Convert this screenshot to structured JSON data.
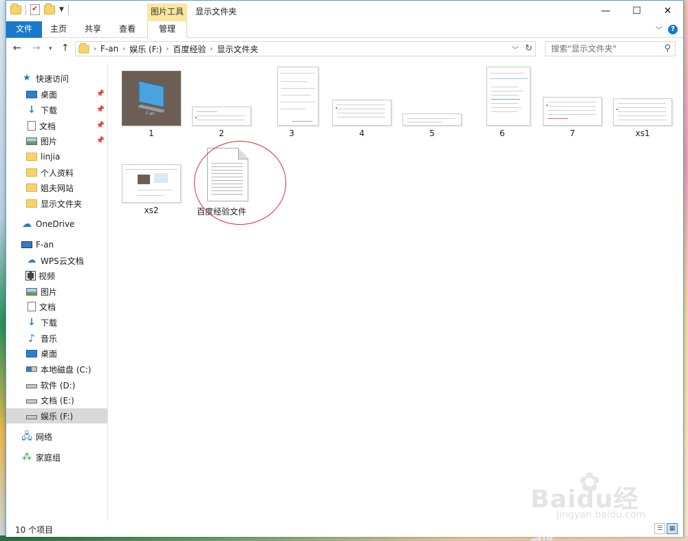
{
  "window": {
    "title": "显示文件夹",
    "context_tab_group": "图片工具",
    "caption": {
      "minimize": "—",
      "maximize": "☐",
      "close": "✕"
    }
  },
  "ribbon": {
    "tabs": [
      {
        "label": "文件",
        "active": true
      },
      {
        "label": "主页"
      },
      {
        "label": "共享"
      },
      {
        "label": "查看"
      },
      {
        "label": "管理"
      }
    ],
    "help": "?"
  },
  "address": {
    "crumbs": [
      "F-an",
      "娱乐 (F:)",
      "百度经验",
      "显示文件夹"
    ],
    "search_placeholder": "搜索\"显示文件夹\""
  },
  "sidebar": {
    "quick_access": {
      "label": "快速访问",
      "items": [
        {
          "label": "桌面",
          "icon": "desktop-icon",
          "pinned": true
        },
        {
          "label": "下载",
          "icon": "download-icon",
          "pinned": true
        },
        {
          "label": "文档",
          "icon": "document-icon",
          "pinned": true
        },
        {
          "label": "图片",
          "icon": "picture-icon",
          "pinned": true
        },
        {
          "label": "linjia",
          "icon": "folder-icon"
        },
        {
          "label": "个人资料",
          "icon": "folder-icon"
        },
        {
          "label": "姐夫网站",
          "icon": "folder-icon"
        },
        {
          "label": "显示文件夹",
          "icon": "folder-icon"
        }
      ]
    },
    "onedrive": "OneDrive",
    "this_pc": {
      "label": "F-an",
      "items": [
        {
          "label": "WPS云文档",
          "icon": "wps-cloud-icon"
        },
        {
          "label": "视频",
          "icon": "video-icon"
        },
        {
          "label": "图片",
          "icon": "picture-icon"
        },
        {
          "label": "文档",
          "icon": "document-icon"
        },
        {
          "label": "下载",
          "icon": "download-icon"
        },
        {
          "label": "音乐",
          "icon": "music-icon"
        },
        {
          "label": "桌面",
          "icon": "desktop-icon"
        },
        {
          "label": "本地磁盘 (C:)",
          "icon": "system-drive-icon"
        },
        {
          "label": "软件 (D:)",
          "icon": "drive-icon"
        },
        {
          "label": "文档 (E:)",
          "icon": "drive-icon"
        },
        {
          "label": "娱乐 (F:)",
          "icon": "drive-icon",
          "selected": true
        }
      ]
    },
    "network": "网络",
    "homegroup": "家庭组"
  },
  "files": [
    {
      "name": "1"
    },
    {
      "name": "2"
    },
    {
      "name": "3"
    },
    {
      "name": "4"
    },
    {
      "name": "5"
    },
    {
      "name": "6"
    },
    {
      "name": "7"
    },
    {
      "name": "xs1"
    },
    {
      "name": "xs2"
    },
    {
      "name": "百度经验文件"
    }
  ],
  "thumb1_caption": "F-an",
  "status": {
    "count": "10 个项目"
  },
  "watermark": {
    "brand": "Baidu经验",
    "url": "jingyan.baidu.com"
  },
  "colors": {
    "accent": "#1979ca",
    "context_tab": "#f9e79f",
    "highlight_circle": "#d32f2f"
  }
}
